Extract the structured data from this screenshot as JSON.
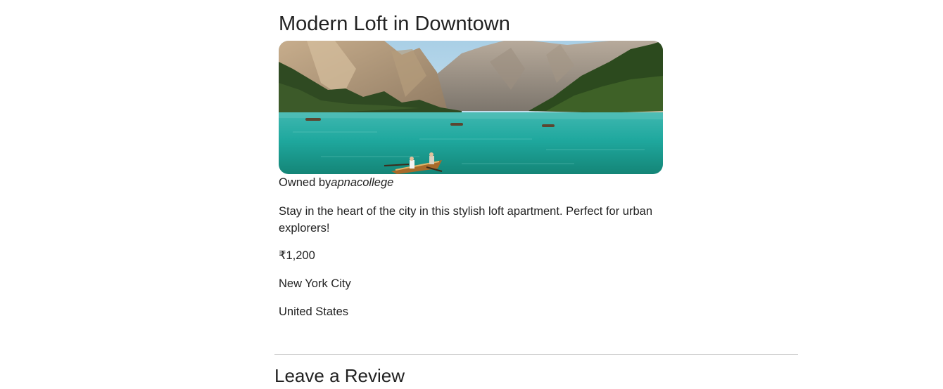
{
  "listing": {
    "title": "Modern Loft in Downtown",
    "image_alt": "Turquoise mountain lake with rowing boats",
    "owner_prefix": "Owned by",
    "owner_name": "apnacollege",
    "description": "Stay in the heart of the city in this stylish loft apartment. Perfect for urban explorers!",
    "price": "₹1,200",
    "location": "New York City",
    "country": "United States"
  },
  "reviews": {
    "heading": "Leave a Review"
  }
}
